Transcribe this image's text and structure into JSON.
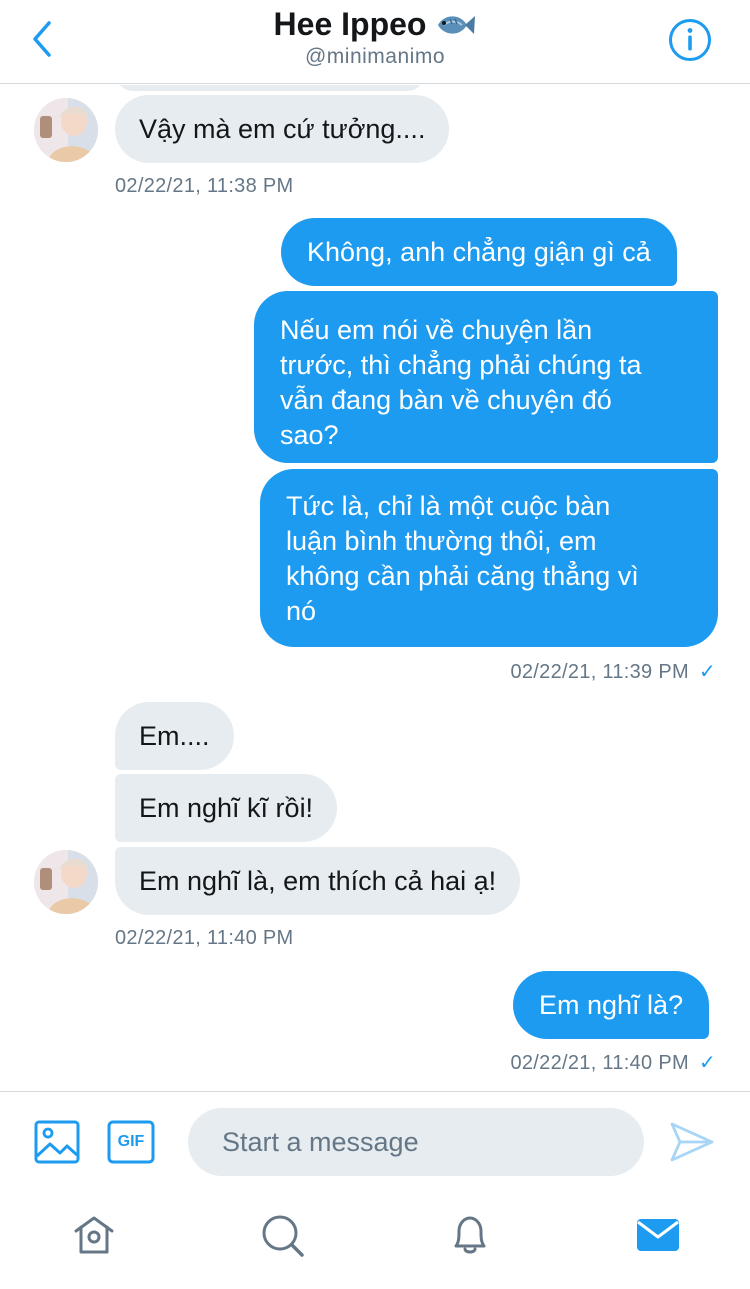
{
  "header": {
    "title": "Hee Ippeo",
    "title_emoji": "fish",
    "handle": "@minimanimo",
    "back_icon": "chevron-left-icon",
    "info_icon": "info-icon"
  },
  "messages": {
    "m1": {
      "text": "Vậy mà em cứ tưởng....",
      "direction": "incoming"
    },
    "t1": "02/22/21, 11:38 PM",
    "m2": {
      "text": "Không, anh chẳng giận gì cả",
      "direction": "outgoing"
    },
    "m3": {
      "line1": "Nếu em nói về chuyện lần",
      "line2": "trước, thì chẳng phải chúng ta",
      "line3": "vẫn đang bàn về chuyện đó",
      "line4": "sao?",
      "direction": "outgoing"
    },
    "m4": {
      "line1": "Tức là, chỉ là một cuộc bàn",
      "line2": "luận bình thường thôi, em",
      "line3": "không cần phải căng thẳng vì",
      "line4": "nó",
      "direction": "outgoing"
    },
    "t2": "02/22/21, 11:39 PM",
    "m5": {
      "text": "Em....",
      "direction": "incoming"
    },
    "m6": {
      "text": "Em nghĩ kĩ rồi!",
      "direction": "incoming"
    },
    "m7": {
      "text": "Em nghĩ là, em thích cả hai ạ!",
      "direction": "incoming"
    },
    "t3": "02/22/21, 11:40 PM",
    "m8": {
      "text": "Em nghĩ là?",
      "direction": "outgoing"
    },
    "t4": "02/22/21, 11:40 PM",
    "read_check": "✓"
  },
  "composer": {
    "placeholder": "Start a message",
    "image_icon": "image-icon",
    "gif_label": "GIF",
    "send_icon": "send-icon"
  },
  "tabbar": {
    "items": [
      "home-icon",
      "search-icon",
      "notifications-icon",
      "messages-icon"
    ],
    "active": "messages-icon"
  },
  "colors": {
    "accent": "#1d9bf0",
    "incoming_bubble": "#e6ecf0",
    "muted_text": "#657786"
  }
}
